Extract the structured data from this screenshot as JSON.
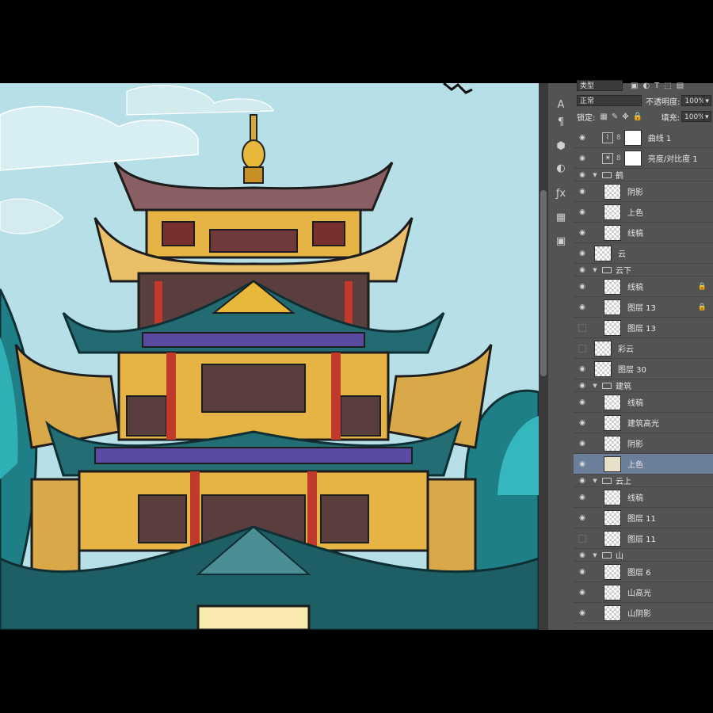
{
  "panel": {
    "filter_label": "类型",
    "blend_mode": "正常",
    "opacity_label": "不透明度:",
    "opacity_value": "100%",
    "lock_label": "锁定:",
    "fill_label": "填充:",
    "fill_value": "100%"
  },
  "layers": [
    {
      "name": "曲线 1",
      "kind": "adjustment",
      "icon": "curves-icon",
      "visible": true
    },
    {
      "name": "亮度/对比度 1",
      "kind": "adjustment",
      "icon": "brightness-icon",
      "visible": true
    },
    {
      "name": "鹤",
      "kind": "group",
      "visible": true
    },
    {
      "name": "阴影",
      "kind": "layer",
      "visible": true
    },
    {
      "name": "上色",
      "kind": "layer",
      "visible": true
    },
    {
      "name": "线稿",
      "kind": "layer",
      "visible": true
    },
    {
      "name": "云",
      "kind": "layer",
      "visible": true
    },
    {
      "name": "云下",
      "kind": "group",
      "visible": true
    },
    {
      "name": "线稿",
      "kind": "layer",
      "visible": true,
      "locked": true
    },
    {
      "name": "图层 13",
      "kind": "layer",
      "visible": true,
      "locked": true
    },
    {
      "name": "图层 13",
      "kind": "layer",
      "visible": false
    },
    {
      "name": "彩云",
      "kind": "layer",
      "visible": false
    },
    {
      "name": "图层 30",
      "kind": "layer",
      "visible": true
    },
    {
      "name": "建筑",
      "kind": "group",
      "visible": true
    },
    {
      "name": "线稿",
      "kind": "layer",
      "visible": true
    },
    {
      "name": "建筑高光",
      "kind": "layer",
      "visible": true
    },
    {
      "name": "阴影",
      "kind": "layer",
      "visible": true
    },
    {
      "name": "上色",
      "kind": "layer",
      "visible": true,
      "selected": true
    },
    {
      "name": "云上",
      "kind": "group",
      "visible": true
    },
    {
      "name": "线稿",
      "kind": "layer",
      "visible": true
    },
    {
      "name": "图层 11",
      "kind": "layer",
      "visible": true
    },
    {
      "name": "图层 11",
      "kind": "layer",
      "visible": false
    },
    {
      "name": "山",
      "kind": "group",
      "visible": true
    },
    {
      "name": "图层 6",
      "kind": "layer",
      "visible": true
    },
    {
      "name": "山高光",
      "kind": "layer",
      "visible": true
    },
    {
      "name": "山阴影",
      "kind": "layer",
      "visible": true
    }
  ],
  "tools": [
    "type-tool-icon",
    "paragraph-icon",
    "3d-icon",
    "adjustments-icon",
    "styles-icon",
    "swatches-icon",
    "properties-icon"
  ],
  "colors": {
    "sky": "#b7dfe7",
    "teal": "#2b8a8c",
    "gold": "#e8b83a",
    "red": "#c0392b",
    "purple": "#5b4ba0",
    "selected_row": "#6b7f9a"
  }
}
